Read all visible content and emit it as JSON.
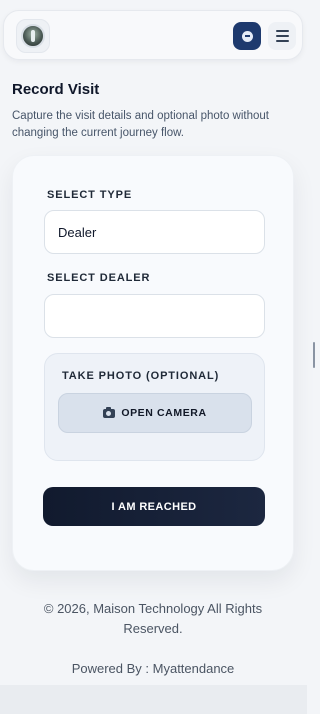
{
  "header": {
    "avatar_icon": "user-avatar-icon",
    "notification_icon": "notification-icon",
    "menu_icon": "hamburger-menu-icon",
    "accent_color": "#1e3a6e"
  },
  "page": {
    "title": "Record Visit",
    "subtitle": "Capture the visit details and optional photo without changing the current journey flow."
  },
  "form": {
    "type_label": "SELECT TYPE",
    "type_value": "Dealer",
    "dealer_label": "SELECT DEALER",
    "dealer_value": "",
    "photo_label": "TAKE PHOTO (OPTIONAL)",
    "camera_button": "OPEN CAMERA",
    "camera_icon": "camera-icon",
    "submit_button": "I AM REACHED"
  },
  "footer": {
    "copyright": "© 2026, Maison Technology All Rights Reserved.",
    "powered_by": "Powered By : Myattendance"
  }
}
